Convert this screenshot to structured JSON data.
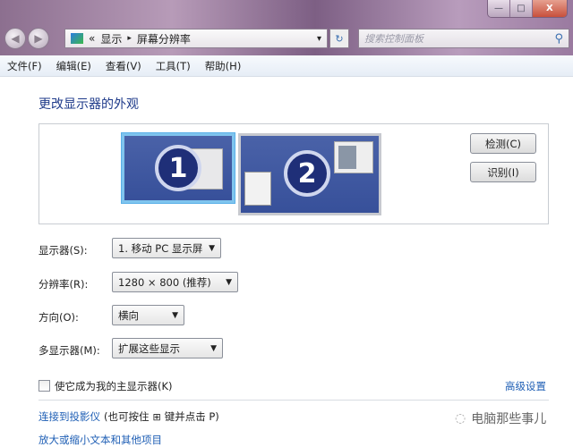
{
  "window": {
    "minimize": "—",
    "maximize": "□",
    "close": "X"
  },
  "nav": {
    "back": "◀",
    "forward": "▶",
    "breadcrumb_prefix": "«",
    "breadcrumb": [
      "显示",
      "屏幕分辨率"
    ],
    "separator": "▸",
    "dropdown": "▾",
    "refresh": "↻",
    "search_placeholder": "搜索控制面板"
  },
  "menu": [
    "文件(F)",
    "编辑(E)",
    "查看(V)",
    "工具(T)",
    "帮助(H)"
  ],
  "heading": "更改显示器的外观",
  "preview": {
    "monitor1": "1",
    "monitor2": "2",
    "detect": "检测(C)",
    "identify": "识别(I)"
  },
  "settings": [
    {
      "label": "显示器(S):",
      "value": "1. 移动 PC 显示屏"
    },
    {
      "label": "分辨率(R):",
      "value": "1280 × 800 (推荐)"
    },
    {
      "label": "方向(O):",
      "value": "横向"
    },
    {
      "label": "多显示器(M):",
      "value": "扩展这些显示"
    }
  ],
  "primary_checkbox": {
    "label": "使它成为我的主显示器(K)",
    "checked": false
  },
  "advanced": "高级设置",
  "projector": {
    "link": "连接到投影仪",
    "hint_pre": "(也可按住",
    "hint_post": "键并点击 P)"
  },
  "text_size_link": "放大或缩小文本和其他项目",
  "watermark": "电脑那些事儿"
}
